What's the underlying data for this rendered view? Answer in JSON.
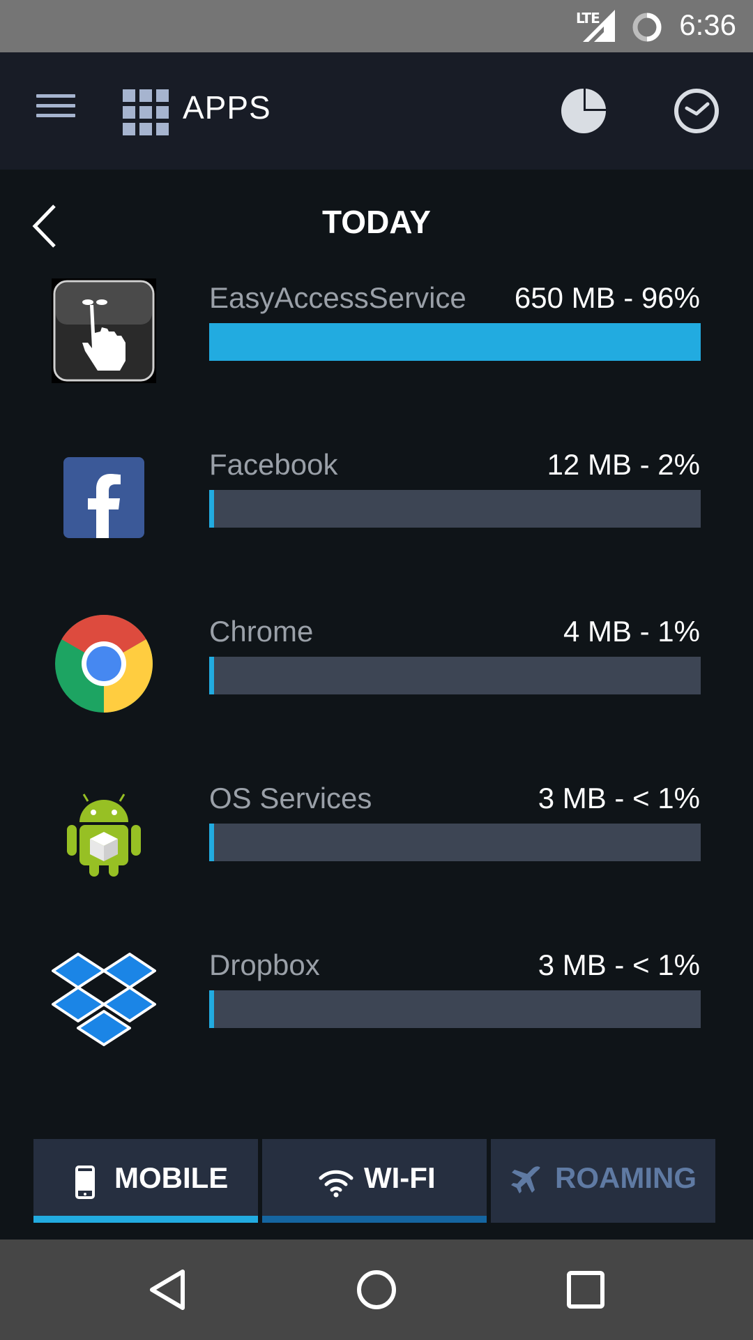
{
  "status_bar": {
    "network": "LTE",
    "time": "6:36"
  },
  "app_bar": {
    "title": "APPS"
  },
  "period": {
    "title": "TODAY"
  },
  "apps": [
    {
      "name": "EasyAccessService",
      "usage": "650 MB - 96%",
      "fraction": 1.0,
      "icon": "touch-hand-icon"
    },
    {
      "name": "Facebook",
      "usage": "12 MB - 2%",
      "fraction": 0.0,
      "icon": "facebook-icon"
    },
    {
      "name": "Chrome",
      "usage": "4 MB - 1%",
      "fraction": 0.0,
      "icon": "chrome-icon"
    },
    {
      "name": "OS Services",
      "usage": "3 MB - < 1%",
      "fraction": 0.0,
      "icon": "android-icon"
    },
    {
      "name": "Dropbox",
      "usage": "3 MB - < 1%",
      "fraction": 0.0,
      "icon": "dropbox-icon"
    }
  ],
  "tabs": [
    {
      "label": "MOBILE",
      "icon": "phone-icon",
      "state": "active"
    },
    {
      "label": "WI-FI",
      "icon": "wifi-icon",
      "state": "inactive"
    },
    {
      "label": "ROAMING",
      "icon": "airplane-icon",
      "state": "disabled"
    }
  ],
  "colors": {
    "accent": "#22abe0",
    "bar_track": "#3d4554",
    "app_bar": "#181c26",
    "background": "#0f1418",
    "tab_bg": "#262f40",
    "disabled_text": "#5f7aa3"
  }
}
